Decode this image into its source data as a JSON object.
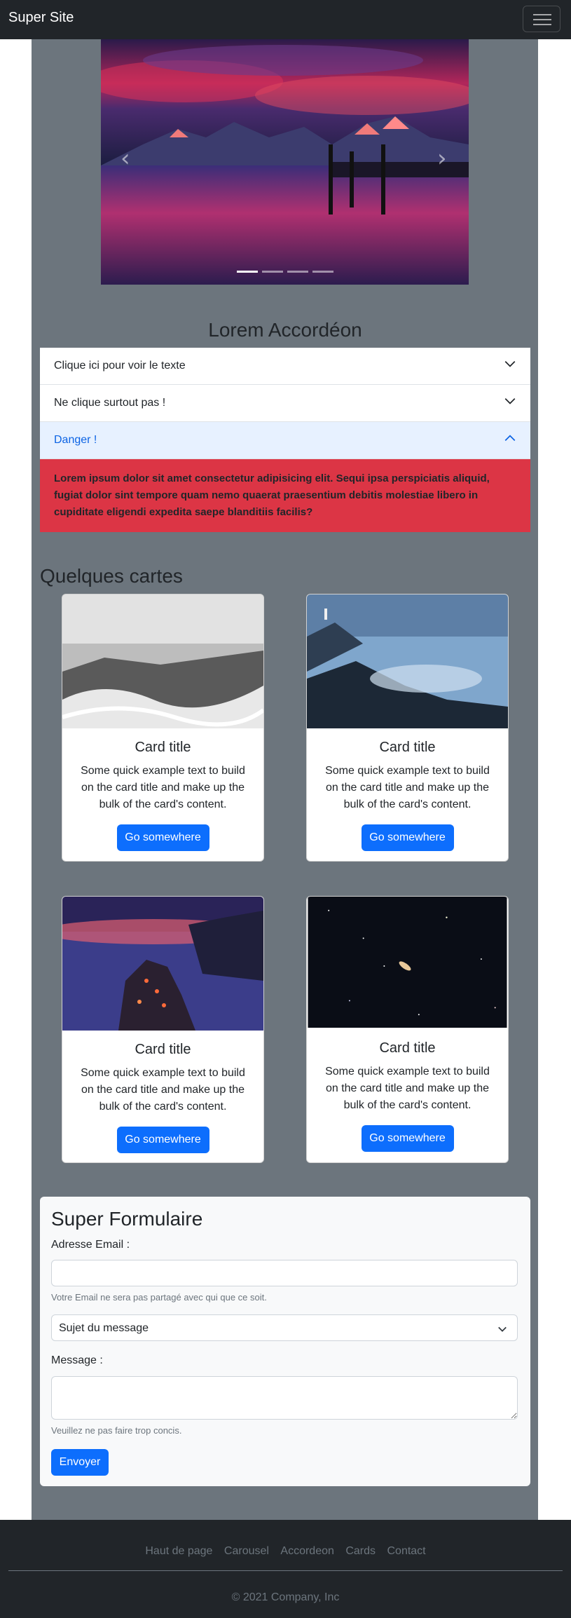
{
  "navbar": {
    "brand": "Super Site",
    "toggler_icon": "hamburger-icon"
  },
  "carousel": {
    "prev_icon": "chevron-left-icon",
    "next_icon": "chevron-right-icon",
    "slide_count": 4,
    "active_slide": 1
  },
  "accordion": {
    "title": "Lorem Accordéon",
    "items": [
      {
        "label": "Clique ici pour voir le texte",
        "expanded": false
      },
      {
        "label": "Ne clique surtout pas !",
        "expanded": false
      },
      {
        "label": "Danger !",
        "expanded": true
      }
    ],
    "open_body": "Lorem ipsum dolor sit amet consectetur adipisicing elit. Sequi ipsa perspiciatis aliquid, fugiat dolor sint tempore quam nemo quaerat praesentium debitis molestiae libero in cupiditate eligendi expedita saepe blanditiis facilis?",
    "danger_color": "#dc3545"
  },
  "cards": {
    "title": "Quelques cartes",
    "items": [
      {
        "title": "Card title",
        "text": "Some quick example text to build on the card title and make up the bulk of the card's content.",
        "button": "Go somewhere"
      },
      {
        "title": "Card title",
        "text": "Some quick example text to build on the card title and make up the bulk of the card's content.",
        "button": "Go somewhere"
      },
      {
        "title": "Card title",
        "text": "Some quick example text to build on the card title and make up the bulk of the card's content.",
        "button": "Go somewhere"
      },
      {
        "title": "Card title",
        "text": "Some quick example text to build on the card title and make up the bulk of the card's content.",
        "button": "Go somewhere"
      }
    ]
  },
  "form": {
    "title": "Super Formulaire",
    "email_label": "Adresse Email :",
    "email_value": "",
    "email_help": "Votre Email ne sera pas partagé avec qui que ce soit.",
    "subject_selected": "Sujet du message",
    "message_label": "Message :",
    "message_value": "",
    "message_help": "Veuillez ne pas faire trop concis.",
    "submit": "Envoyer"
  },
  "footer": {
    "links": [
      "Haut de page",
      "Carousel",
      "Accordeon",
      "Cards",
      "Contact"
    ],
    "copyright": "© 2021 Company, Inc"
  },
  "colors": {
    "primary": "#0d6efd",
    "dark": "#212529",
    "secondary": "#6c757d"
  }
}
